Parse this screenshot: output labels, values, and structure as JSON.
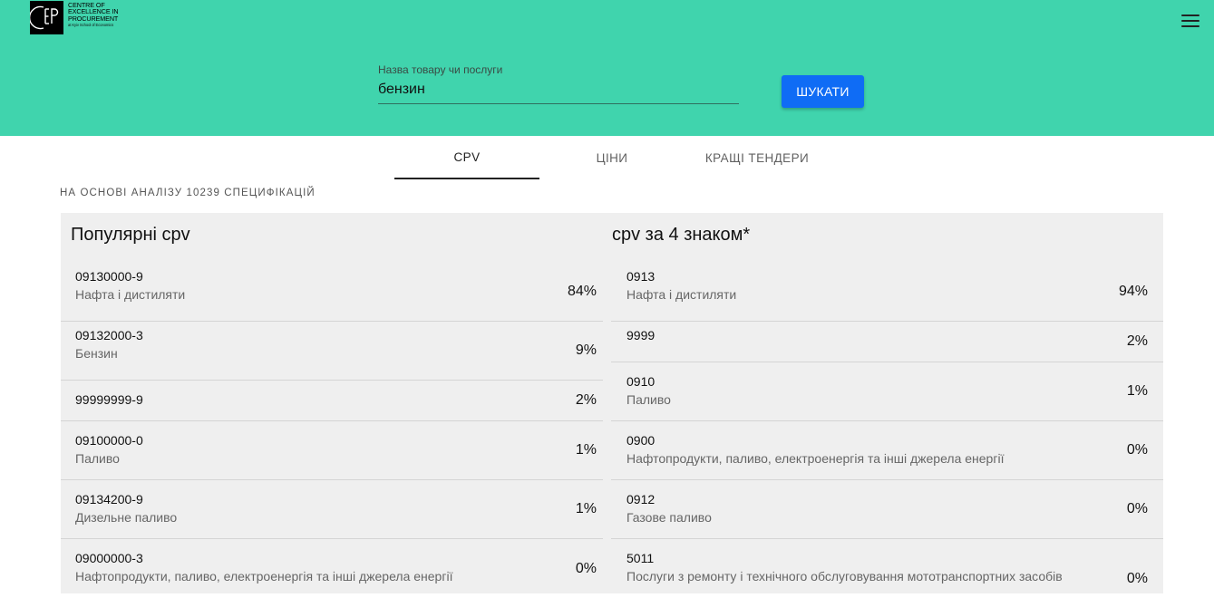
{
  "logo": {
    "mark": "CEP",
    "lines": [
      "CENTRE OF",
      "EXCELLENCE IN",
      "PROCUREMENT"
    ],
    "sub": "at Kyiv School of Economics"
  },
  "search": {
    "label": "Назва товару чи послуги",
    "value": "бензин",
    "button": "ШУКАТИ"
  },
  "tabs": [
    {
      "label": "CPV",
      "active": true
    },
    {
      "label": "ЦІНИ",
      "active": false
    },
    {
      "label": "КРАЩІ ТЕНДЕРИ",
      "active": false
    }
  ],
  "caption": "НА ОСНОВІ АНАЛІЗУ 10239 СПЕЦИФІКАЦІЙ",
  "popular": {
    "title": "Популярні cpv",
    "rows": [
      {
        "code": "09130000-9",
        "desc": "Нафта і дистиляти",
        "pct": "84%"
      },
      {
        "code": "09132000-3",
        "desc": "Бензин",
        "pct": "9%"
      },
      {
        "code": "99999999-9",
        "desc": "",
        "pct": "2%"
      },
      {
        "code": "09100000-0",
        "desc": "Паливо",
        "pct": "1%"
      },
      {
        "code": "09134200-9",
        "desc": "Дизельне паливо",
        "pct": "1%"
      },
      {
        "code": "09000000-3",
        "desc": "Нафтопродукти, паливо, електроенергія та інші джерела енергії",
        "pct": "0%"
      }
    ]
  },
  "by4": {
    "title": "cpv за 4 знаком*",
    "rows": [
      {
        "code": "0913",
        "desc": "Нафта і дистиляти",
        "pct": "94%"
      },
      {
        "code": "9999",
        "desc": "",
        "pct": "2%"
      },
      {
        "code": "0910",
        "desc": "Паливо",
        "pct": "1%"
      },
      {
        "code": "0900",
        "desc": "Нафтопродукти, паливо, електроенергія та інші джерела енергії",
        "pct": "0%"
      },
      {
        "code": "0912",
        "desc": "Газове паливо",
        "pct": "0%"
      },
      {
        "code": "5011",
        "desc": "Послуги з ремонту і технічного обслуговування мототранспортних засобів",
        "pct": "0%"
      }
    ]
  }
}
